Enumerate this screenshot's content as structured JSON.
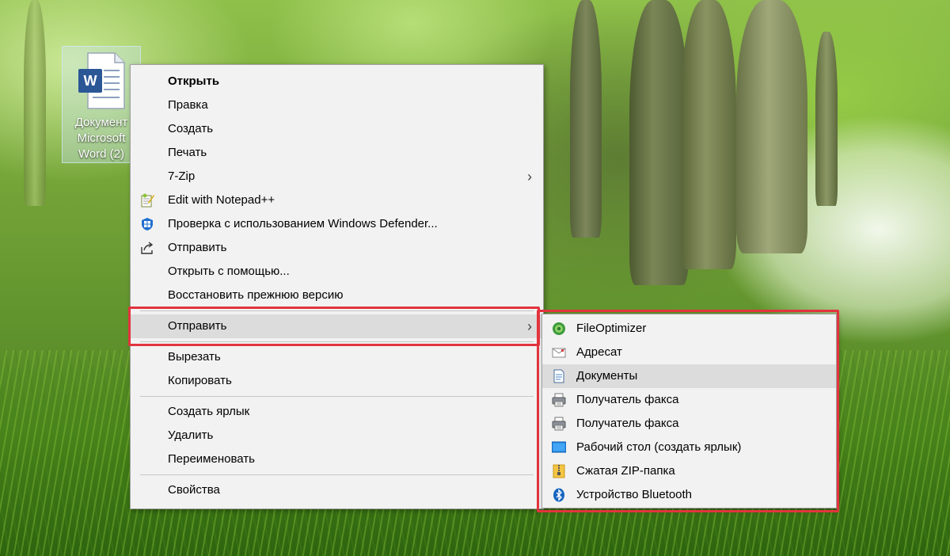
{
  "desktop": {
    "icon_label": "Документ\nMicrosoft\nWord (2)"
  },
  "context_menu": {
    "items": [
      {
        "label": "Открыть",
        "bold": true
      },
      {
        "label": "Правка"
      },
      {
        "label": "Создать"
      },
      {
        "label": "Печать"
      },
      {
        "label": "7-Zip",
        "submenu": true
      },
      {
        "label": "Edit with Notepad++",
        "icon": "notepadpp-icon"
      },
      {
        "label": "Проверка с использованием Windows Defender...",
        "icon": "windows-defender-icon"
      },
      {
        "label": "Отправить",
        "icon": "share-icon"
      },
      {
        "label": "Открыть с помощью..."
      },
      {
        "label": "Восстановить прежнюю версию"
      },
      {
        "label": "Отправить",
        "submenu": true,
        "selected": true
      },
      {
        "label": "Вырезать"
      },
      {
        "label": "Копировать"
      },
      {
        "label": "Создать ярлык"
      },
      {
        "label": "Удалить"
      },
      {
        "label": "Переименовать"
      },
      {
        "label": "Свойства"
      }
    ]
  },
  "send_to_submenu": {
    "items": [
      {
        "label": "FileOptimizer",
        "icon": "fileoptimizer-icon"
      },
      {
        "label": "Адресат",
        "icon": "mail-recipient-icon"
      },
      {
        "label": "Документы",
        "icon": "documents-icon",
        "hover": true
      },
      {
        "label": "Получатель факса",
        "icon": "fax-icon"
      },
      {
        "label": "Получатель факса",
        "icon": "fax-icon"
      },
      {
        "label": "Рабочий стол (создать ярлык)",
        "icon": "desktop-icon"
      },
      {
        "label": "Сжатая ZIP-папка",
        "icon": "zip-folder-icon"
      },
      {
        "label": "Устройство Bluetooth",
        "icon": "bluetooth-icon"
      }
    ]
  },
  "colors": {
    "highlight_border": "#e2343e",
    "menu_background": "#f2f2f2",
    "selected_row": "#dcdcdc"
  }
}
